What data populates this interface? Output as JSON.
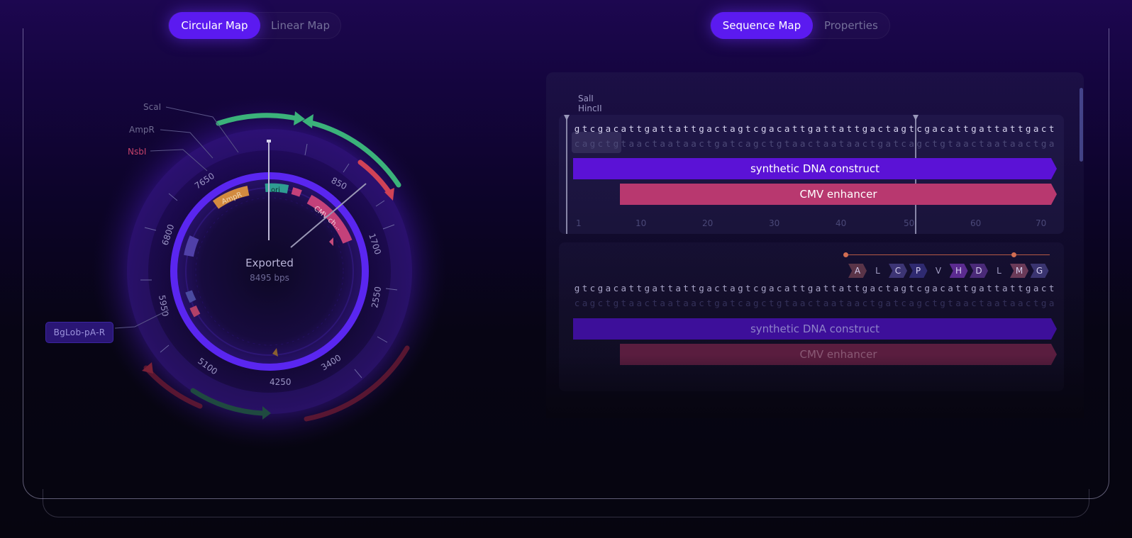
{
  "left_tabs": [
    {
      "label": "Circular Map",
      "active": true
    },
    {
      "label": "Linear Map",
      "active": false
    }
  ],
  "right_tabs": [
    {
      "label": "Sequence Map",
      "active": true
    },
    {
      "label": "Properties",
      "active": false
    }
  ],
  "circular_map": {
    "center_title": "Exported",
    "center_subtitle": "8495 bps",
    "ticks": [
      "850",
      "1700",
      "2550",
      "3400",
      "4250",
      "5100",
      "5950",
      "6800",
      "7650"
    ],
    "enzymes": [
      {
        "label": "ScaI",
        "color": "#6e6a90"
      },
      {
        "label": "AmpR",
        "color": "#6e6a90"
      },
      {
        "label": "NsbI",
        "color": "#c4416a"
      }
    ],
    "features": [
      "AmpR",
      "ori",
      "CMV ch..."
    ],
    "callout": "BgLob-pA-R"
  },
  "sequence_map": {
    "enzymes": [
      "SalI",
      "HincII"
    ],
    "block1": {
      "top": "gtcgacattgattattgactagtcgacattgattattgactagtcgacattgattattgact",
      "bottom": "cagctgtaactaataactgatcagctgtaactaataactgatcagctgtaactaataactga",
      "features": [
        {
          "label": "synthetic DNA construct",
          "color": "#5b12d6"
        },
        {
          "label": "CMV enhancer",
          "color": "#b8386f"
        }
      ],
      "ruler": [
        "1",
        "10",
        "20",
        "30",
        "40",
        "50",
        "60",
        "70"
      ]
    },
    "block2": {
      "amino_acids": [
        "A",
        "L",
        "C",
        "P",
        "V",
        "H",
        "D",
        "L",
        "M",
        "G"
      ],
      "top": "gtcgacattgattattgactagtcgacattgattattgactagtcgacattgattattgact",
      "bottom": "cagctgtaactaataactgatcagctgtaactaataactgatcagctgtaactaataactga",
      "features": [
        {
          "label": "synthetic DNA construct",
          "color": "#3d0f9a"
        },
        {
          "label": "CMV enhancer",
          "color": "#5a1d3f"
        }
      ]
    }
  },
  "colors": {
    "accent": "#5b1af0",
    "green": "#3bb27a",
    "red": "#d04256",
    "orange": "#d28a3f",
    "teal": "#2f9c92"
  }
}
